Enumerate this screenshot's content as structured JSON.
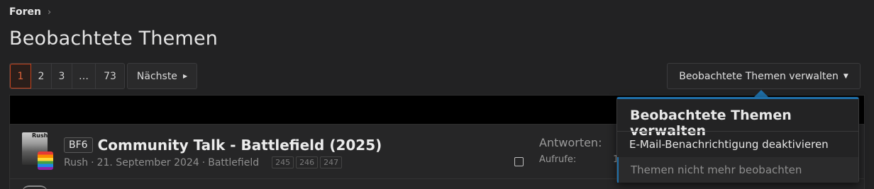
{
  "breadcrumb": {
    "label": "Foren",
    "chevron": "›"
  },
  "page_title": "Beobachtete Themen",
  "pagination": {
    "pages": [
      "1",
      "2",
      "3",
      "…",
      "73"
    ],
    "current": "1",
    "next_label": "Nächste"
  },
  "manage_button": {
    "label": "Beobachtete Themen verwalten"
  },
  "menu": {
    "title": "Beobachtete Themen verwalten",
    "items": [
      "E-Mail-Benachrichtigung deaktivieren",
      "Themen nicht mehr beobachten"
    ]
  },
  "thread": {
    "avatar_name": "Rush",
    "prefix": "BF6",
    "title": "Community Talk - Battlefield (2025)",
    "author": "Rush",
    "date": "21. September 2024",
    "forum": "Battlefield",
    "page_links": [
      "245",
      "246",
      "247"
    ],
    "replies_label": "Antworten:",
    "views_label": "Aufrufe:",
    "views_value": "1"
  },
  "colors": {
    "background": "#222223",
    "accent": "#c4421c",
    "menu_accent": "#1f6fa8"
  }
}
